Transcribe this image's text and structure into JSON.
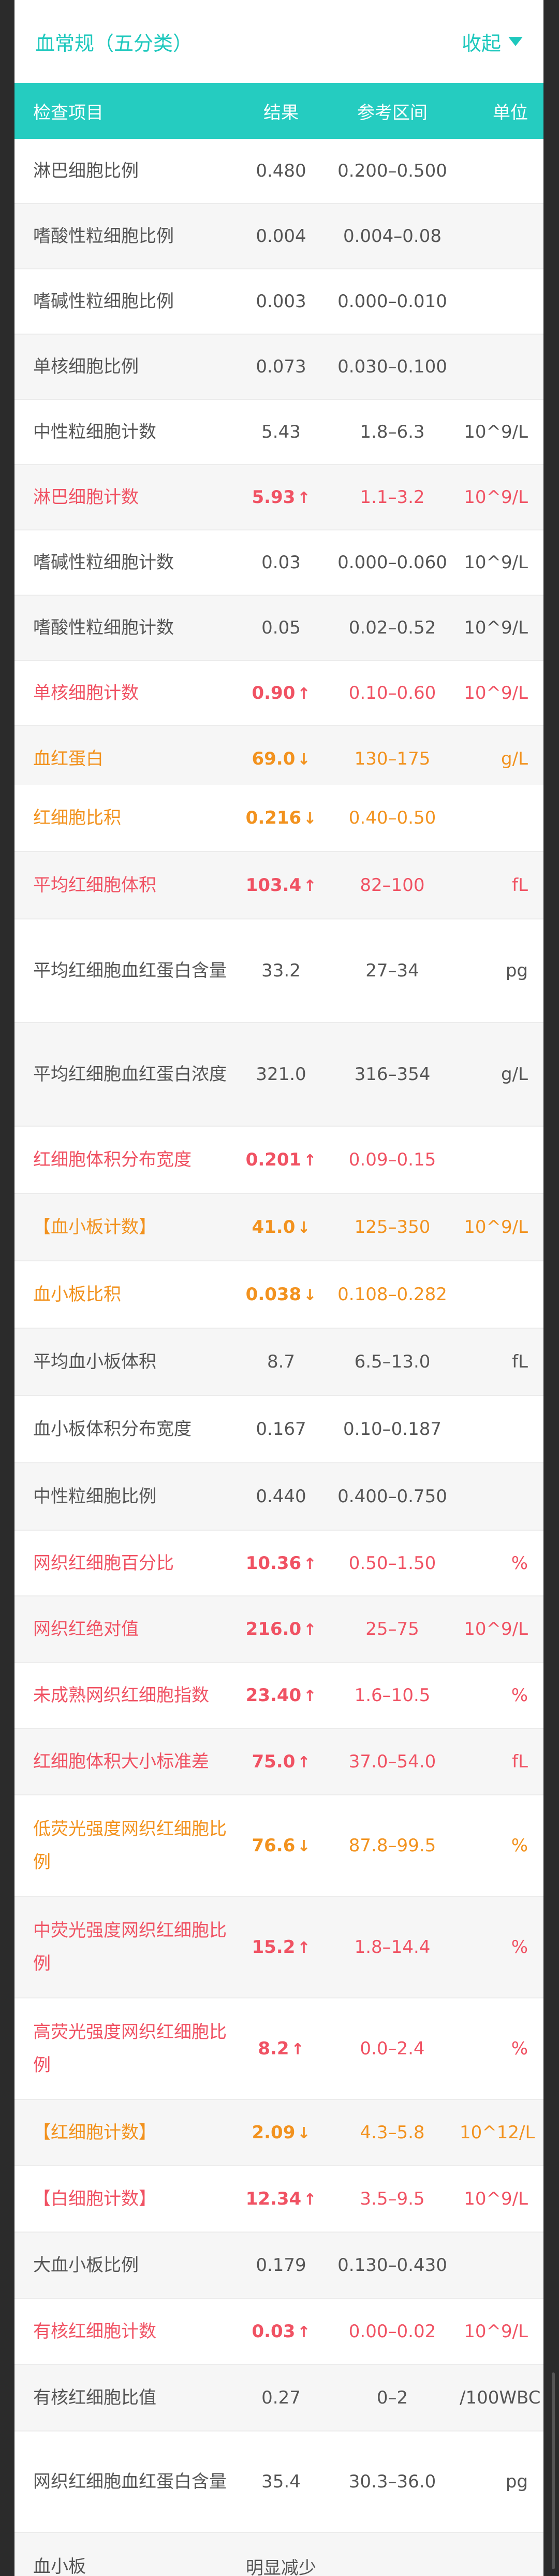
{
  "header": {
    "title": "血常规（五分类）",
    "collapse_label": "收起"
  },
  "columns": {
    "name": "检查项目",
    "result": "结果",
    "range": "参考区间",
    "unit": "单位"
  },
  "rows": [
    {
      "name": "淋巴细胞比例",
      "result": "0.480",
      "arrow": "",
      "range": "0.200–0.500",
      "unit": "",
      "status": "normal"
    },
    {
      "name": "嗜酸性粒细胞比例",
      "result": "0.004",
      "arrow": "",
      "range": "0.004–0.08",
      "unit": "",
      "status": "normal"
    },
    {
      "name": "嗜碱性粒细胞比例",
      "result": "0.003",
      "arrow": "",
      "range": "0.000–0.010",
      "unit": "",
      "status": "normal"
    },
    {
      "name": "单核细胞比例",
      "result": "0.073",
      "arrow": "",
      "range": "0.030–0.100",
      "unit": "",
      "status": "normal"
    },
    {
      "name": "中性粒细胞计数",
      "result": "5.43",
      "arrow": "",
      "range": "1.8–6.3",
      "unit": "10^9/L",
      "status": "normal"
    },
    {
      "name": "淋巴细胞计数",
      "result": "5.93",
      "arrow": "↑",
      "range": "1.1–3.2",
      "unit": "10^9/L",
      "status": "high"
    },
    {
      "name": "嗜碱性粒细胞计数",
      "result": "0.03",
      "arrow": "",
      "range": "0.000–0.060",
      "unit": "10^9/L",
      "status": "normal"
    },
    {
      "name": "嗜酸性粒细胞计数",
      "result": "0.05",
      "arrow": "",
      "range": "0.02–0.52",
      "unit": "10^9/L",
      "status": "normal"
    },
    {
      "name": "单核细胞计数",
      "result": "0.90",
      "arrow": "↑",
      "range": "0.10–0.60",
      "unit": "10^9/L",
      "status": "high"
    },
    {
      "name": "血红蛋白",
      "result": "69.0",
      "arrow": "↓",
      "range": "130–175",
      "unit": "g/L",
      "status": "low"
    },
    {
      "name": "红细胞比积",
      "result": "0.216",
      "arrow": "↓",
      "range": "0.40–0.50",
      "unit": "",
      "status": "low"
    },
    {
      "name": "平均红细胞体积",
      "result": "103.4",
      "arrow": "↑",
      "range": "82–100",
      "unit": "fL",
      "status": "high"
    },
    {
      "name": "平均红细胞血红蛋白含量",
      "result": "33.2",
      "arrow": "",
      "range": "27–34",
      "unit": "pg",
      "status": "normal"
    },
    {
      "name": "平均红细胞血红蛋白浓度",
      "result": "321.0",
      "arrow": "",
      "range": "316–354",
      "unit": "g/L",
      "status": "normal"
    },
    {
      "name": "红细胞体积分布宽度",
      "result": "0.201",
      "arrow": "↑",
      "range": "0.09–0.15",
      "unit": "",
      "status": "high"
    },
    {
      "name": "【血小板计数】",
      "result": "41.0",
      "arrow": "↓",
      "range": "125–350",
      "unit": "10^9/L",
      "status": "low"
    },
    {
      "name": "血小板比积",
      "result": "0.038",
      "arrow": "↓",
      "range": "0.108–0.282",
      "unit": "",
      "status": "low"
    },
    {
      "name": "平均血小板体积",
      "result": "8.7",
      "arrow": "",
      "range": "6.5–13.0",
      "unit": "fL",
      "status": "normal"
    },
    {
      "name": "血小板体积分布宽度",
      "result": "0.167",
      "arrow": "",
      "range": "0.10–0.187",
      "unit": "",
      "status": "normal"
    },
    {
      "name": "中性粒细胞比例",
      "result": "0.440",
      "arrow": "",
      "range": "0.400–0.750",
      "unit": "",
      "status": "normal"
    },
    {
      "name": "网织红细胞百分比",
      "result": "10.36",
      "arrow": "↑",
      "range": "0.50–1.50",
      "unit": "%",
      "status": "high"
    },
    {
      "name": "网织红绝对值",
      "result": "216.0",
      "arrow": "↑",
      "range": "25–75",
      "unit": "10^9/L",
      "status": "high"
    },
    {
      "name": "未成熟网织红细胞指数",
      "result": "23.40",
      "arrow": "↑",
      "range": "1.6–10.5",
      "unit": "%",
      "status": "high"
    },
    {
      "name": "红细胞体积大小标准差",
      "result": "75.0",
      "arrow": "↑",
      "range": "37.0–54.0",
      "unit": "fL",
      "status": "high"
    },
    {
      "name": "低荧光强度网织红细胞比例",
      "result": "76.6",
      "arrow": "↓",
      "range": "87.8–99.5",
      "unit": "%",
      "status": "low"
    },
    {
      "name": "中荧光强度网织红细胞比例",
      "result": "15.2",
      "arrow": "↑",
      "range": "1.8–14.4",
      "unit": "%",
      "status": "high"
    },
    {
      "name": "高荧光强度网织红细胞比例",
      "result": "8.2",
      "arrow": "↑",
      "range": "0.0–2.4",
      "unit": "%",
      "status": "high"
    },
    {
      "name": "【红细胞计数】",
      "result": "2.09",
      "arrow": "↓",
      "range": "4.3–5.8",
      "unit": "10^12/L",
      "status": "low"
    },
    {
      "name": "【白细胞计数】",
      "result": "12.34",
      "arrow": "↑",
      "range": "3.5–9.5",
      "unit": "10^9/L",
      "status": "high"
    },
    {
      "name": "大血小板比例",
      "result": "0.179",
      "arrow": "",
      "range": "0.130–0.430",
      "unit": "",
      "status": "normal"
    },
    {
      "name": "有核红细胞计数",
      "result": "0.03",
      "arrow": "↑",
      "range": "0.00–0.02",
      "unit": "10^9/L",
      "status": "high"
    },
    {
      "name": "有核红细胞比值",
      "result": "0.27",
      "arrow": "",
      "range": "0–2",
      "unit": "/100WBC",
      "status": "normal"
    },
    {
      "name": "网织红细胞血红蛋白含量",
      "result": "35.4",
      "arrow": "",
      "range": "30.3–36.0",
      "unit": "pg",
      "status": "normal"
    },
    {
      "name": "血小板",
      "result": "明显减少",
      "arrow": "",
      "range": "",
      "unit": "",
      "status": "normal"
    }
  ]
}
